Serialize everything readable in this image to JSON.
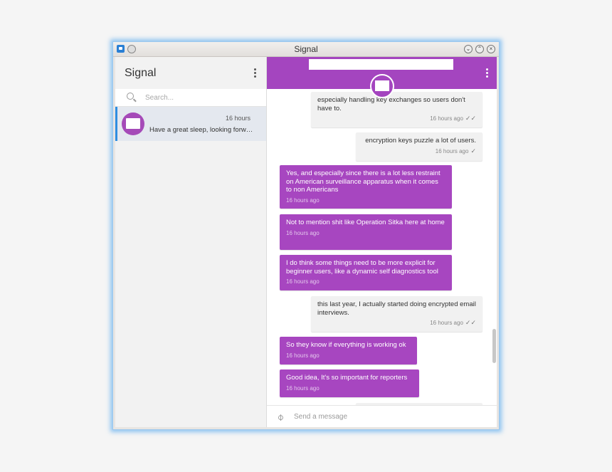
{
  "window": {
    "title": "Signal"
  },
  "sidebar": {
    "title": "Signal",
    "search_placeholder": "Search...",
    "conversation": {
      "time": "16 hours",
      "snippet": "Have a great sleep, looking forwar..."
    }
  },
  "messages": [
    {
      "dir": "in",
      "text": "especially handling key exchanges so users don't have to.",
      "time": "16 hours ago",
      "status": "read"
    },
    {
      "dir": "in",
      "text": "encryption keys puzzle a lot of users.",
      "time": "16 hours ago",
      "status": "delivered"
    },
    {
      "dir": "out",
      "text": "Yes, and especially since there is a lot less restraint on American surveillance apparatus when it comes to non Americans",
      "time": "16 hours ago"
    },
    {
      "dir": "out",
      "text": "Not to mention shit like Operation Sitka here at home",
      "time": "16 hours ago"
    },
    {
      "dir": "out",
      "text": "I do think some things need to be more explicit for beginner users, like a dynamic self diagnostics tool",
      "time": "16 hours ago"
    },
    {
      "dir": "in",
      "text": "this last year, I actually started doing encrypted email interviews.",
      "time": "16 hours ago",
      "status": "read"
    },
    {
      "dir": "out",
      "text": "So they know if everything is working ok",
      "time": "16 hours ago"
    },
    {
      "dir": "out",
      "text": "Good idea, It's so important for reporters",
      "time": "16 hours ago"
    }
  ],
  "composer": {
    "placeholder": "Send a message"
  },
  "colors": {
    "accent": "#a445bf",
    "selection": "#2f8ee0"
  },
  "icons": {
    "attach": "paperclip-icon",
    "search": "search-icon",
    "menu": "kebab-menu-icon"
  }
}
